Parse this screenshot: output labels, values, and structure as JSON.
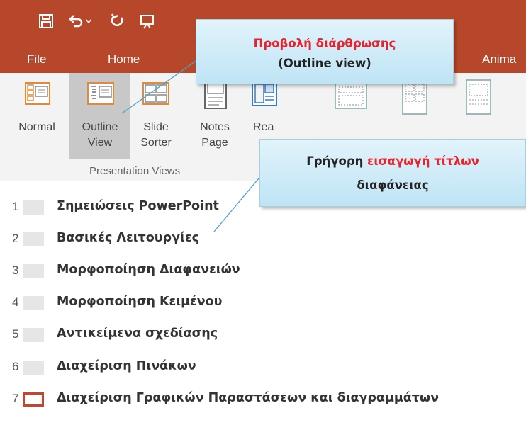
{
  "quick_access": {
    "save_icon": "save-icon",
    "undo_icon": "undo-icon",
    "dropdown_icon": "chevron-down-icon",
    "redo_icon": "redo-icon",
    "present_icon": "start-from-beginning-icon"
  },
  "tabs": [
    {
      "label": "File"
    },
    {
      "label": "Home"
    },
    {
      "label": "Anima"
    }
  ],
  "ribbon": {
    "buttons": [
      {
        "label": "Normal",
        "icon": "normal-view-icon"
      },
      {
        "label": "Outline\nView",
        "icon": "outline-view-icon",
        "selected": true
      },
      {
        "label": "Slide\nSorter",
        "icon": "slide-sorter-icon"
      },
      {
        "label": "Notes\nPage",
        "icon": "notes-page-icon"
      },
      {
        "label": "Reading",
        "icon": "reading-view-icon"
      }
    ],
    "group_label": "Presentation Views",
    "master_icons": [
      "slide-master-icon",
      "handout-master-icon",
      "notes-master-icon"
    ]
  },
  "outline": {
    "slides": [
      {
        "number": "1",
        "title": "Σημειώσεις PowerPoint"
      },
      {
        "number": "2",
        "title": "Βασικές Λειτουργίες"
      },
      {
        "number": "3",
        "title": "Μορφοποίηση Διαφανειών"
      },
      {
        "number": "4",
        "title": "Μορφοποίηση Κειμένου"
      },
      {
        "number": "5",
        "title": "Αντικείμενα σχεδίασης"
      },
      {
        "number": "6",
        "title": "Διαχείριση Πινάκων"
      },
      {
        "number": "7",
        "title": "Διαχείριση Γραφικών Παραστάσεων και διαγραμμάτων",
        "active": true
      }
    ]
  },
  "callouts": {
    "outline_view": {
      "line1": "Προβολή διάρθρωσης",
      "line2": "(Outline view)"
    },
    "slide_titles": {
      "prefix": "Γρήγορη ",
      "highlight": "εισαγωγή τίτλων",
      "line2": "διαφάνειας"
    }
  },
  "colors": {
    "title_bar": "#b7472a",
    "callout_red": "#e8222a",
    "active_thumb_border": "#c8452c"
  }
}
